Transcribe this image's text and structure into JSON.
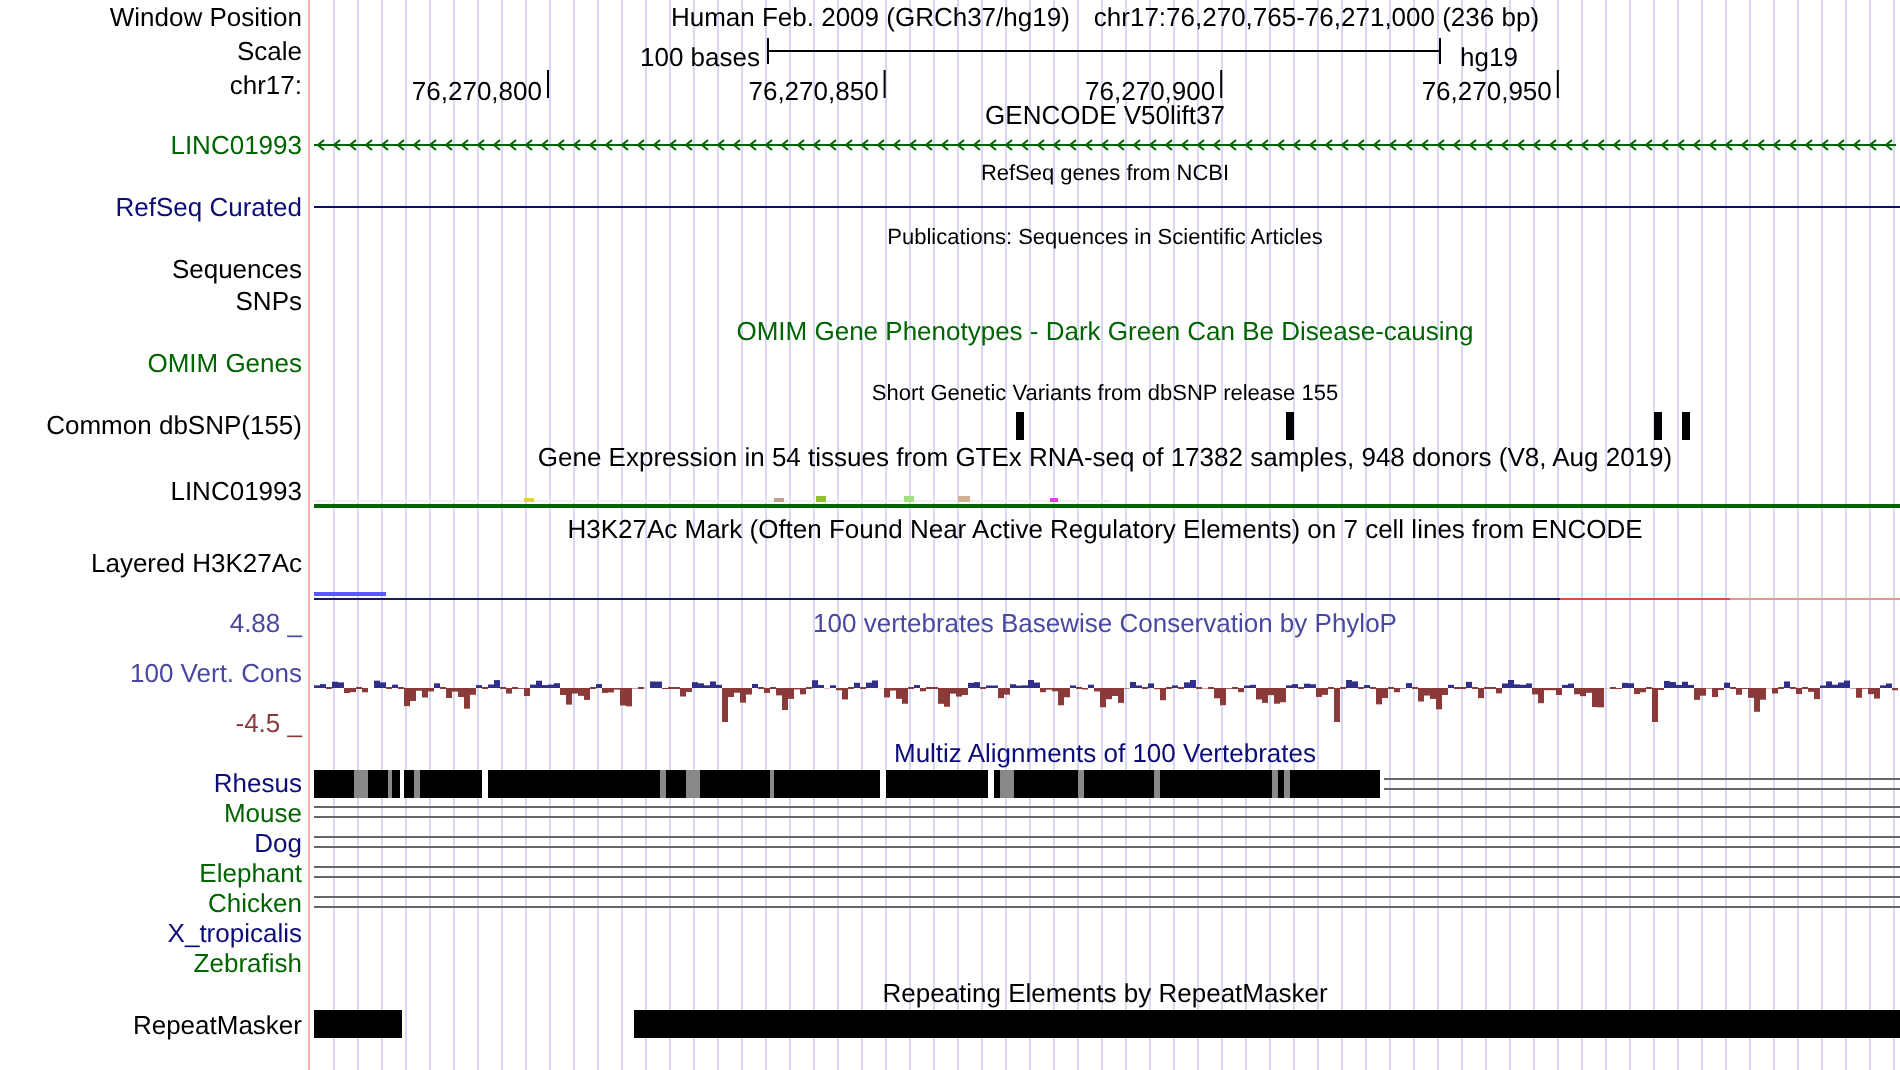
{
  "window_position": {
    "label": "Window Position",
    "assembly": "Human Feb. 2009 (GRCh37/hg19)",
    "position": "chr17:76,270,765-76,271,000 (236 bp)"
  },
  "scale": {
    "label": "Scale",
    "bar_label": "100 bases",
    "assembly": "hg19"
  },
  "ruler": {
    "label": "chr17:",
    "ticks": [
      "76,270,800",
      "76,270,850",
      "76,270,900",
      "76,270,950"
    ]
  },
  "tracks": [
    {
      "kind": "gene",
      "title": "GENCODE V50lift37",
      "labels": [
        "LINC01993"
      ],
      "color": "#006400"
    },
    {
      "kind": "gene_line",
      "title": "RefSeq genes from NCBI",
      "labels": [
        "RefSeq Curated"
      ],
      "color": "#0c0c78"
    },
    {
      "kind": "labels_only",
      "title": "Publications: Sequences in Scientific Articles",
      "labels": [
        "Sequences",
        "SNPs"
      ],
      "color": "#000000"
    },
    {
      "kind": "omim",
      "title": "OMIM Gene Phenotypes - Dark Green Can Be Disease-causing",
      "labels": [
        "OMIM Genes"
      ],
      "color": "#006400"
    },
    {
      "kind": "snp",
      "title": "Short Genetic Variants from dbSNP release 155",
      "labels": [
        "Common dbSNP(155)"
      ],
      "color": "#000000"
    },
    {
      "kind": "expression",
      "title": "Gene Expression in 54 tissues from GTEx RNA-seq of 17382 samples, 948 donors (V8, Aug 2019)",
      "labels": [
        "LINC01993"
      ],
      "color": "#000000"
    },
    {
      "kind": "signal",
      "title": "H3K27Ac Mark (Often Found Near Active Regulatory Elements) on 7 cell lines from ENCODE",
      "labels": [
        "Layered H3K27Ac"
      ],
      "color": "#000000"
    },
    {
      "kind": "conservation",
      "title": "100 vertebrates Basewise Conservation by PhyloP",
      "labels": [
        "4.88 _",
        "100 Vert. Cons",
        "-4.5 _"
      ],
      "color": "#4848a0"
    },
    {
      "kind": "alignment",
      "title": "Multiz Alignments of 100 Vertebrates",
      "color": "#0c0c78",
      "species": [
        {
          "name": "Rhesus",
          "color": "#0c0c78",
          "kind": "blocks"
        },
        {
          "name": "Mouse",
          "color": "#006400",
          "kind": "double_line"
        },
        {
          "name": "Dog",
          "color": "#0c0c78",
          "kind": "double_line"
        },
        {
          "name": "Elephant",
          "color": "#006400",
          "kind": "double_line"
        },
        {
          "name": "Chicken",
          "color": "#006400",
          "kind": "double_line"
        },
        {
          "name": "X_tropicalis",
          "color": "#0c0c78",
          "kind": "none"
        },
        {
          "name": "Zebrafish",
          "color": "#006400",
          "kind": "none"
        }
      ]
    },
    {
      "kind": "repeat",
      "title": "Repeating Elements by RepeatMasker",
      "labels": [
        "RepeatMasker"
      ],
      "color": "#000000"
    }
  ]
}
